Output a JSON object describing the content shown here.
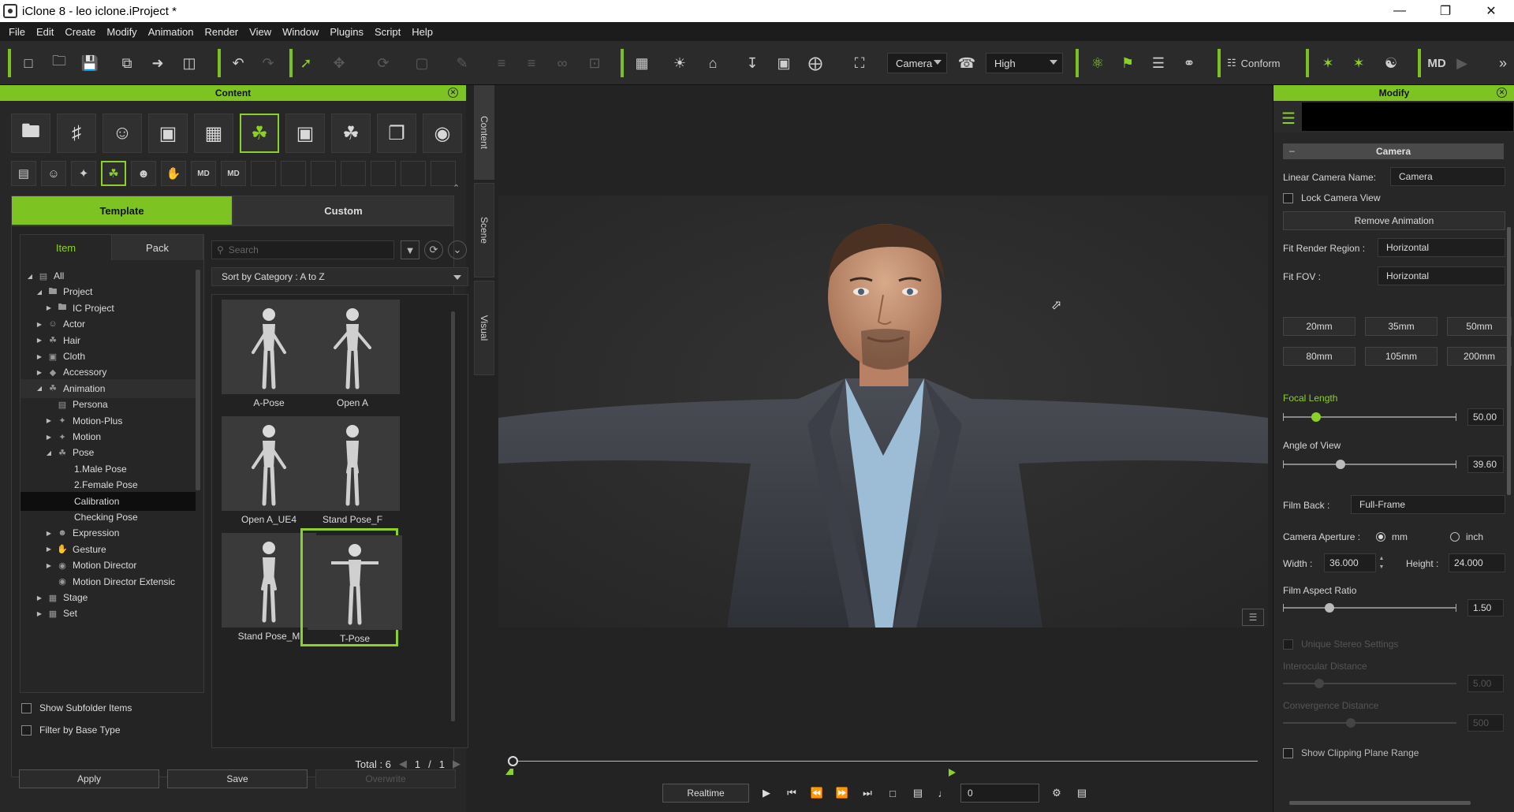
{
  "window": {
    "title": "iClone 8 - leo iclone.iProject *"
  },
  "menu": [
    "File",
    "Edit",
    "Create",
    "Modify",
    "Animation",
    "Render",
    "View",
    "Window",
    "Plugins",
    "Script",
    "Help"
  ],
  "toolbar": {
    "camera_select": "Camera",
    "quality_select": "High",
    "conform_label": "Conform"
  },
  "content_panel": {
    "title": "Content",
    "side_tabs": [
      "Content",
      "Scene",
      "Visual"
    ],
    "tabs": [
      "Template",
      "Custom"
    ],
    "tree_tabs": [
      "Item",
      "Pack"
    ],
    "search_placeholder": "Search",
    "sort_label": "Sort by Category : A to Z",
    "tree": [
      {
        "label": "All",
        "depth": 0,
        "arrow": "open"
      },
      {
        "label": "Project",
        "depth": 1,
        "arrow": "open"
      },
      {
        "label": "IC Project",
        "depth": 2,
        "arrow": "closed"
      },
      {
        "label": "Actor",
        "depth": 1,
        "arrow": "closed"
      },
      {
        "label": "Hair",
        "depth": 1,
        "arrow": "closed"
      },
      {
        "label": "Cloth",
        "depth": 1,
        "arrow": "closed"
      },
      {
        "label": "Accessory",
        "depth": 1,
        "arrow": "closed"
      },
      {
        "label": "Animation",
        "depth": 1,
        "arrow": "open"
      },
      {
        "label": "Persona",
        "depth": 2,
        "arrow": "none"
      },
      {
        "label": "Motion-Plus",
        "depth": 2,
        "arrow": "closed"
      },
      {
        "label": "Motion",
        "depth": 2,
        "arrow": "closed"
      },
      {
        "label": "Pose",
        "depth": 2,
        "arrow": "open"
      },
      {
        "label": "1.Male Pose",
        "depth": 3,
        "arrow": "none"
      },
      {
        "label": "2.Female Pose",
        "depth": 3,
        "arrow": "none"
      },
      {
        "label": "Calibration",
        "depth": 3,
        "arrow": "none"
      },
      {
        "label": "Checking Pose",
        "depth": 3,
        "arrow": "none"
      },
      {
        "label": "Expression",
        "depth": 2,
        "arrow": "closed"
      },
      {
        "label": "Gesture",
        "depth": 2,
        "arrow": "closed"
      },
      {
        "label": "Motion Director",
        "depth": 2,
        "arrow": "closed"
      },
      {
        "label": "Motion Director Extensic",
        "depth": 2,
        "arrow": "none"
      },
      {
        "label": "Stage",
        "depth": 1,
        "arrow": "closed"
      },
      {
        "label": "Set",
        "depth": 1,
        "arrow": "closed"
      }
    ],
    "thumbnails": [
      "A-Pose",
      "Open A",
      "Open A_UE4",
      "Stand Pose_F",
      "Stand Pose_M",
      "T-Pose"
    ],
    "show_subfolder": "Show Subfolder Items",
    "filter_base": "Filter by Base Type",
    "total": "Total : 6",
    "page_current": "1",
    "page_sep": "/",
    "page_total": "1",
    "buttons": {
      "apply": "Apply",
      "save": "Save",
      "overwrite": "Overwrite"
    }
  },
  "playback": {
    "realtime": "Realtime",
    "frame": "0"
  },
  "modify": {
    "title": "Modify",
    "section": "Camera",
    "camera_name_label": "Linear Camera Name:",
    "camera_name_value": "Camera",
    "lock_view": "Lock Camera View",
    "remove_animation": "Remove Animation",
    "fit_render_label": "Fit Render Region :",
    "fit_render_value": "Horizontal",
    "fit_fov_label": "Fit FOV :",
    "fit_fov_value": "Horizontal",
    "lens_presets": [
      "20mm",
      "35mm",
      "50mm",
      "80mm",
      "105mm",
      "200mm"
    ],
    "focal_length_label": "Focal Length",
    "focal_length_value": "50.00",
    "angle_of_view_label": "Angle of View",
    "angle_of_view_value": "39.60",
    "film_back_label": "Film Back :",
    "film_back_value": "Full-Frame",
    "aperture_label": "Camera Aperture :",
    "aperture_mm": "mm",
    "aperture_inch": "inch",
    "width_label": "Width :",
    "width_value": "36.000",
    "height_label": "Height :",
    "height_value": "24.000",
    "aspect_label": "Film Aspect Ratio",
    "aspect_value": "1.50",
    "stereo_label": "Unique Stereo Settings",
    "interocular_label": "Interocular Distance",
    "interocular_value": "5.00",
    "convergence_label": "Convergence Distance",
    "convergence_value": "500",
    "clipping_label": "Show Clipping Plane Range"
  }
}
